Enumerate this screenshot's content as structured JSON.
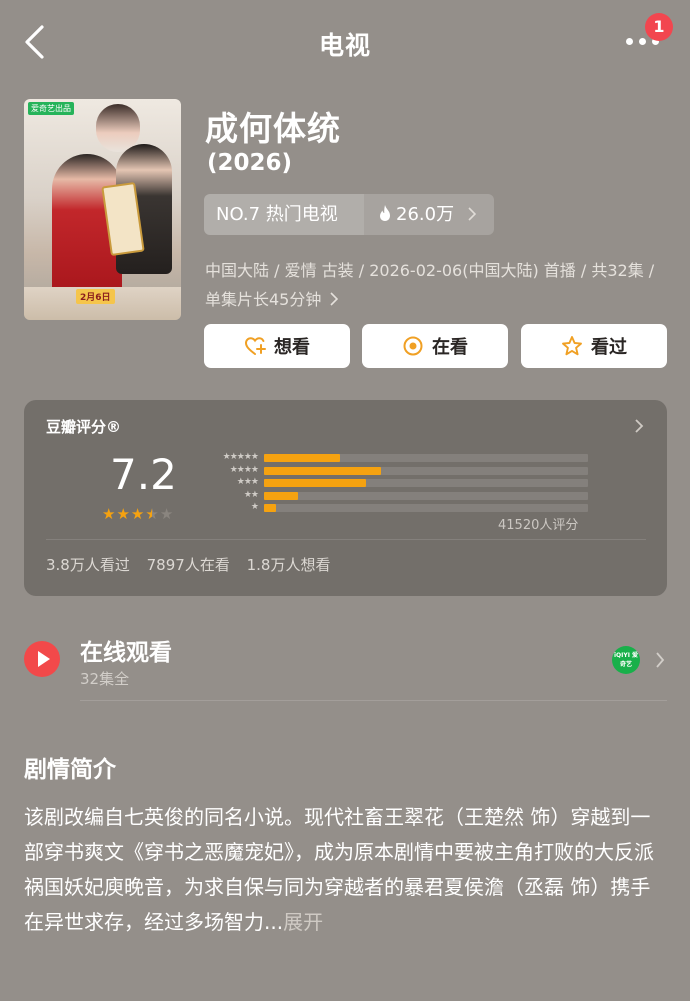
{
  "header": {
    "title": "电视",
    "notification_count": "1"
  },
  "poster": {
    "platform_tag": "爱奇艺出品",
    "date_label": "2月6日"
  },
  "show": {
    "title": "成何体统",
    "year": "(2026)",
    "rank_label": "NO.7 热门电视",
    "heat_value": "26.0万",
    "meta_text": "中国大陆 / 爱情 古装 / 2026-02-06(中国大陆) 首播 / 共32集 / 单集片长45分钟"
  },
  "actions": {
    "want": "想看",
    "watching": "在看",
    "watched": "看过"
  },
  "rating": {
    "title": "豆瓣评分®",
    "score": "7.2",
    "stars_value": 3.5,
    "distribution_pct": [
      22.3,
      34.3,
      30.0,
      10.0,
      3.4
    ],
    "count_label": "41520人评分",
    "stats": {
      "watched": "3.8万人看过",
      "watching": "7897人在看",
      "want": "1.8万人想看"
    },
    "colors": {
      "bar": "#f5a210",
      "star": "#f5a210"
    }
  },
  "watch": {
    "title": "在线观看",
    "subtitle": "32集全",
    "provider": "iQIYI 爱奇艺"
  },
  "synopsis": {
    "title": "剧情简介",
    "text": "该剧改编自七英俊的同名小说。现代社畜王翠花（王楚然 饰）穿越到一部穿书爽文《穿书之恶魔宠妃》，成为原本剧情中要被主角打败的大反派祸国妖妃庾晚音，为求自保与同为穿越者的暴君夏侯澹（丞磊 饰）携手在异世求存，经过多场智力...",
    "expand_label": "展开"
  }
}
